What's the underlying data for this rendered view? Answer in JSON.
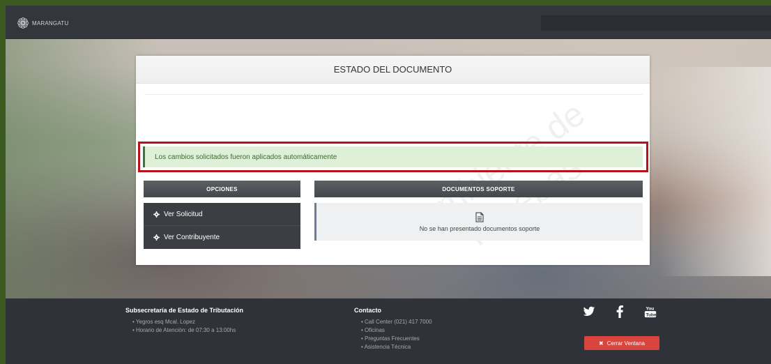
{
  "brand": {
    "name": "MARANGATU",
    "icon": "flower-logo-icon"
  },
  "panel": {
    "title": "ESTADO DEL DOCUMENTO",
    "alert_message": "Los cambios solicitados fueron aplicados automáticamente",
    "watermark_line1": "Ambiente de",
    "watermark_line2": "Pruebas"
  },
  "options": {
    "title": "OPCIONES",
    "items": [
      {
        "label": "Ver Solicitud",
        "icon": "gear-icon"
      },
      {
        "label": "Ver Contribuyente",
        "icon": "gear-icon"
      }
    ]
  },
  "documents": {
    "title": "DOCUMENTOS SOPORTE",
    "empty_message": "No se han presentado documentos soporte",
    "icon": "document-icon"
  },
  "footer": {
    "org_title": "Subsecretaría de Estado de Tributación",
    "org_items": [
      "Yegros esq Mcal. Lopez",
      "Horario de Atención: de 07:30 a 13:00hs"
    ],
    "contact_title": "Contacto",
    "contact_items": [
      "Call Center (021) 417 7000",
      "Oficinas",
      "Preguntas Frecuentes",
      "Asistencia Técnica"
    ],
    "social": [
      "twitter-icon",
      "facebook-icon",
      "youtube-icon"
    ],
    "close_label": "Cerrar Ventana"
  },
  "colors": {
    "alert_bg": "#dff0d8",
    "highlight_border": "#b5121b",
    "close_button": "#d9453c"
  }
}
